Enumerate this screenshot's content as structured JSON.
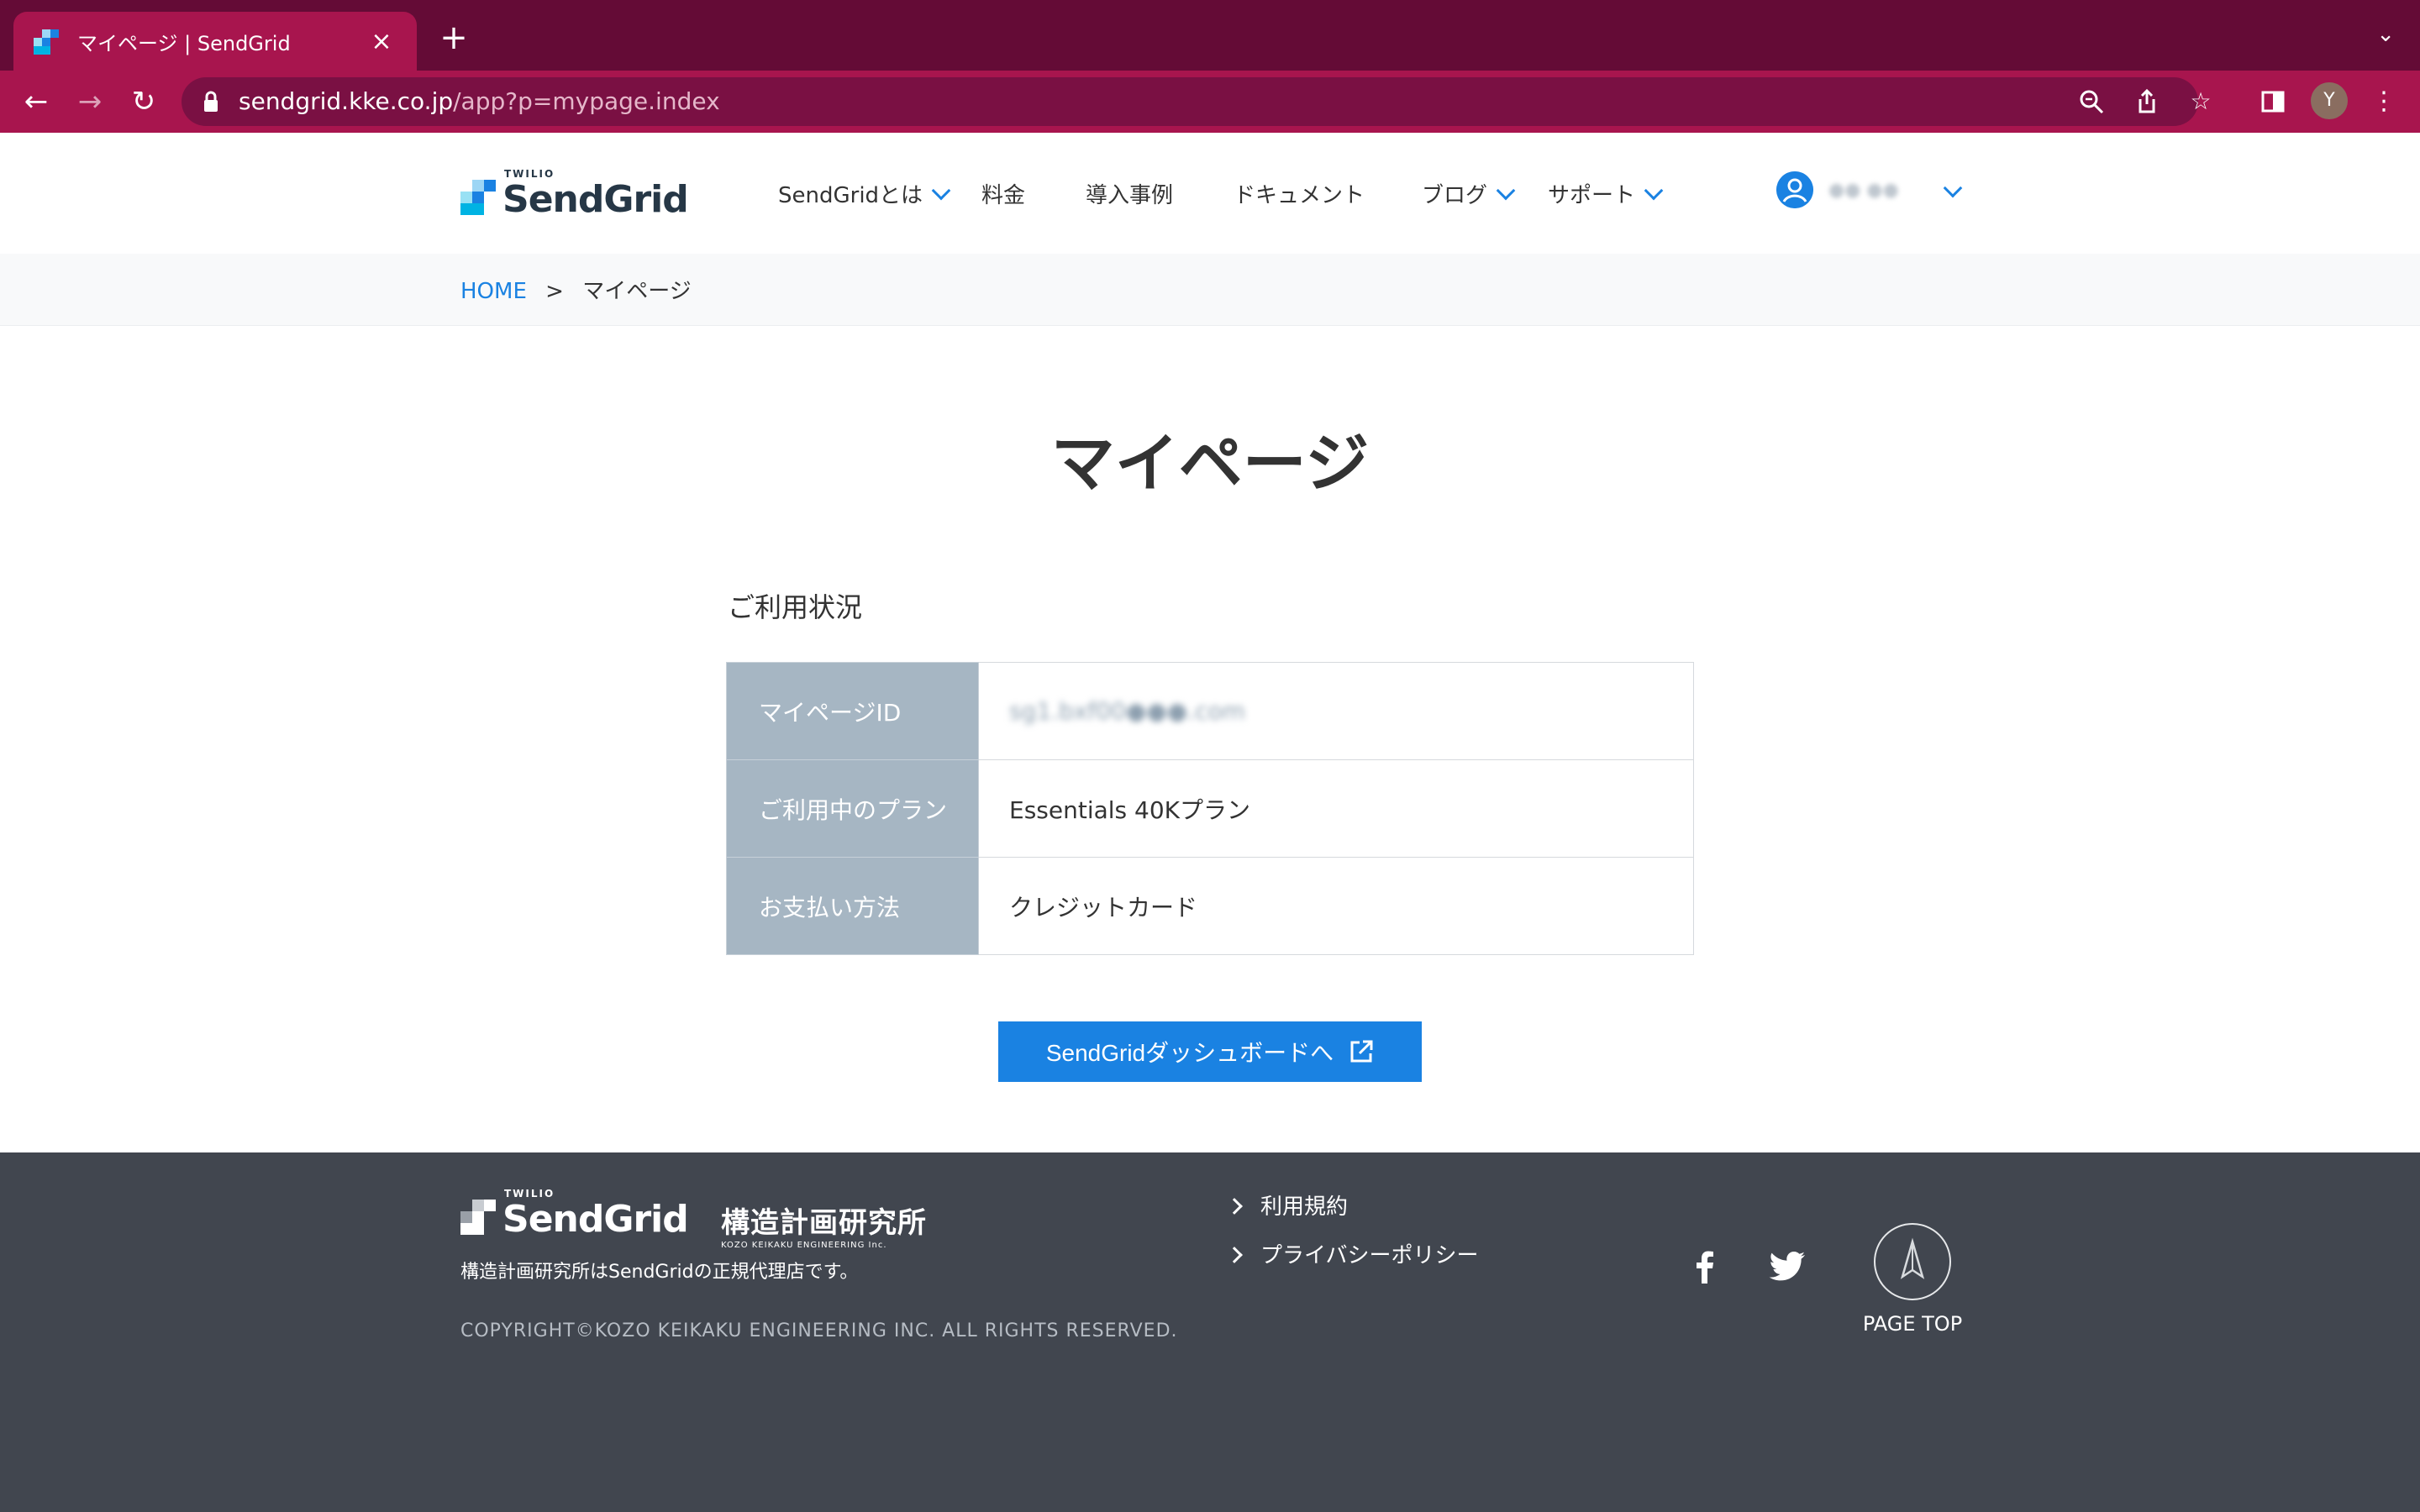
{
  "browser": {
    "tab_title": "マイページ | SendGrid",
    "url_host": "sendgrid.kke.co.jp",
    "url_path": "/app?p=mypage.index",
    "profile_initial": "Y"
  },
  "header": {
    "logo_twilio": "TWILIO",
    "logo_text": "SendGrid",
    "nav": {
      "about": "SendGridとは",
      "pricing": "料金",
      "cases": "導入事例",
      "docs": "ドキュメント",
      "blog": "ブログ",
      "support": "サポート"
    },
    "user_name": "●● ●●"
  },
  "breadcrumb": {
    "home": "HOME",
    "separator": ">",
    "current": "マイページ"
  },
  "main": {
    "title": "マイページ",
    "section_title": "ご利用状況",
    "rows": [
      {
        "label": "マイページID",
        "value": "sg1.bxf00●●●.com"
      },
      {
        "label": "ご利用中のプラン",
        "value": "Essentials 40Kプラン"
      },
      {
        "label": "お支払い方法",
        "value": "クレジットカード"
      }
    ],
    "dashboard_button": "SendGridダッシュボードへ"
  },
  "footer": {
    "logo_twilio": "TWILIO",
    "logo_text": "SendGrid",
    "kke_jp": "構造計画研究所",
    "kke_en": "KOZO KEIKAKU ENGINEERING Inc.",
    "note": "構造計画研究所はSendGridの正規代理店です。",
    "copyright": "COPYRIGHT©KOZO KEIKAKU ENGINEERING INC. ALL RIGHTS RESERVED.",
    "links": [
      "利用規約",
      "プライバシーポリシー"
    ],
    "page_top": "PAGE TOP"
  },
  "colors": {
    "browser_tabbar": "#640b36",
    "browser_toolbar": "#a8154e",
    "accent": "#1a82e2",
    "table_header": "#a6b6c3",
    "footer_bg": "#41464f"
  }
}
